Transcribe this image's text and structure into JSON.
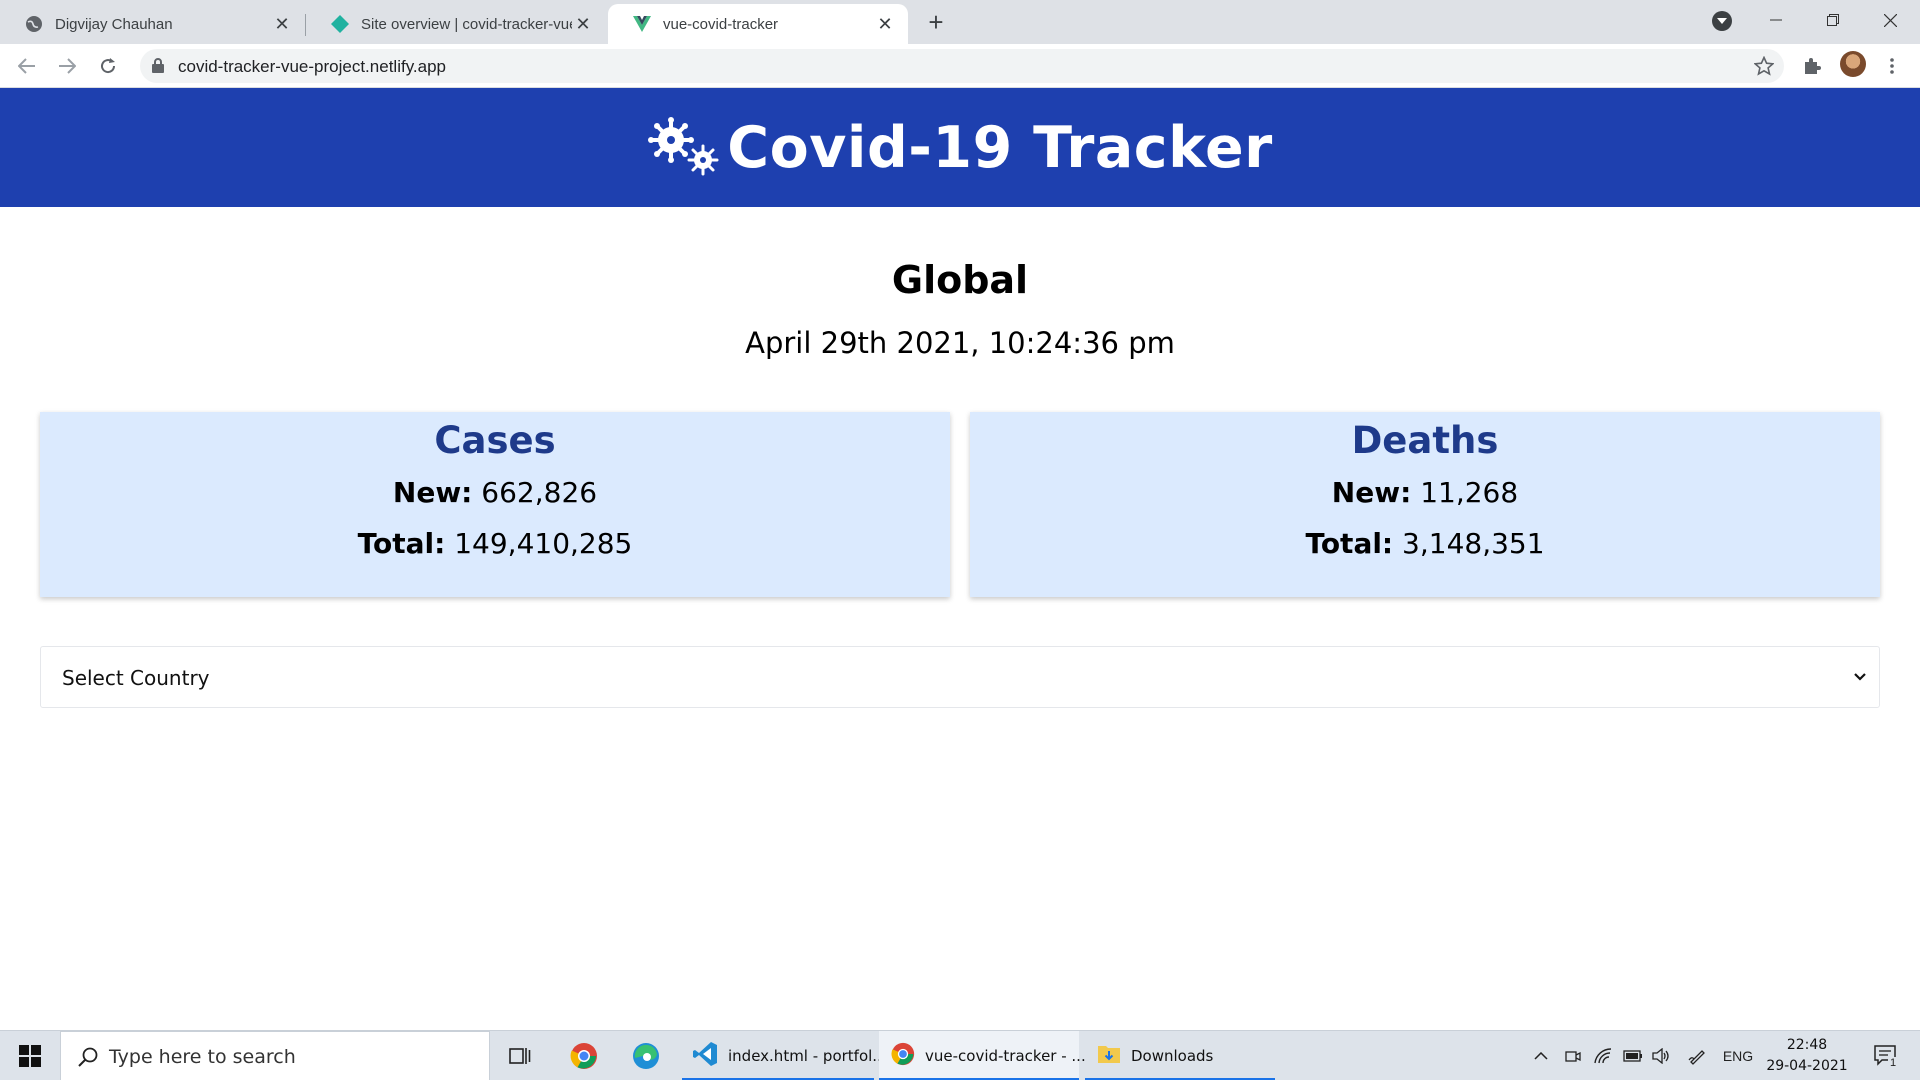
{
  "browser": {
    "tabs": [
      {
        "title": "Digvijay Chauhan",
        "icon": "globe-icon"
      },
      {
        "title": "Site overview | covid-tracker-vue",
        "icon": "netlify-icon"
      },
      {
        "title": "vue-covid-tracker",
        "icon": "vue-icon"
      }
    ],
    "url": "covid-tracker-vue-project.netlify.app"
  },
  "page": {
    "header_title": "Covid-19 Tracker",
    "region_title": "Global",
    "date": "April 29th 2021, 10:24:36 pm",
    "cards": [
      {
        "title": "Cases",
        "new_label": "New:",
        "new_value": "662,826",
        "total_label": "Total:",
        "total_value": "149,410,285"
      },
      {
        "title": "Deaths",
        "new_label": "New:",
        "new_value": "11,268",
        "total_label": "Total:",
        "total_value": "3,148,351"
      }
    ],
    "country_select": {
      "selected": "Select Country"
    }
  },
  "taskbar": {
    "search_placeholder": "Type here to search",
    "apps": [
      {
        "label": "index.html - portfol...",
        "icon": "vscode-icon"
      },
      {
        "label": "vue-covid-tracker - ...",
        "icon": "chrome-icon"
      },
      {
        "label": "Downloads",
        "icon": "folder-icon"
      }
    ],
    "language": "ENG",
    "time": "22:48",
    "date": "29-04-2021",
    "notification_count": "1"
  },
  "colors": {
    "header_bg": "#1e40af",
    "card_bg": "#dbeafe",
    "card_title": "#1e3a8a"
  }
}
